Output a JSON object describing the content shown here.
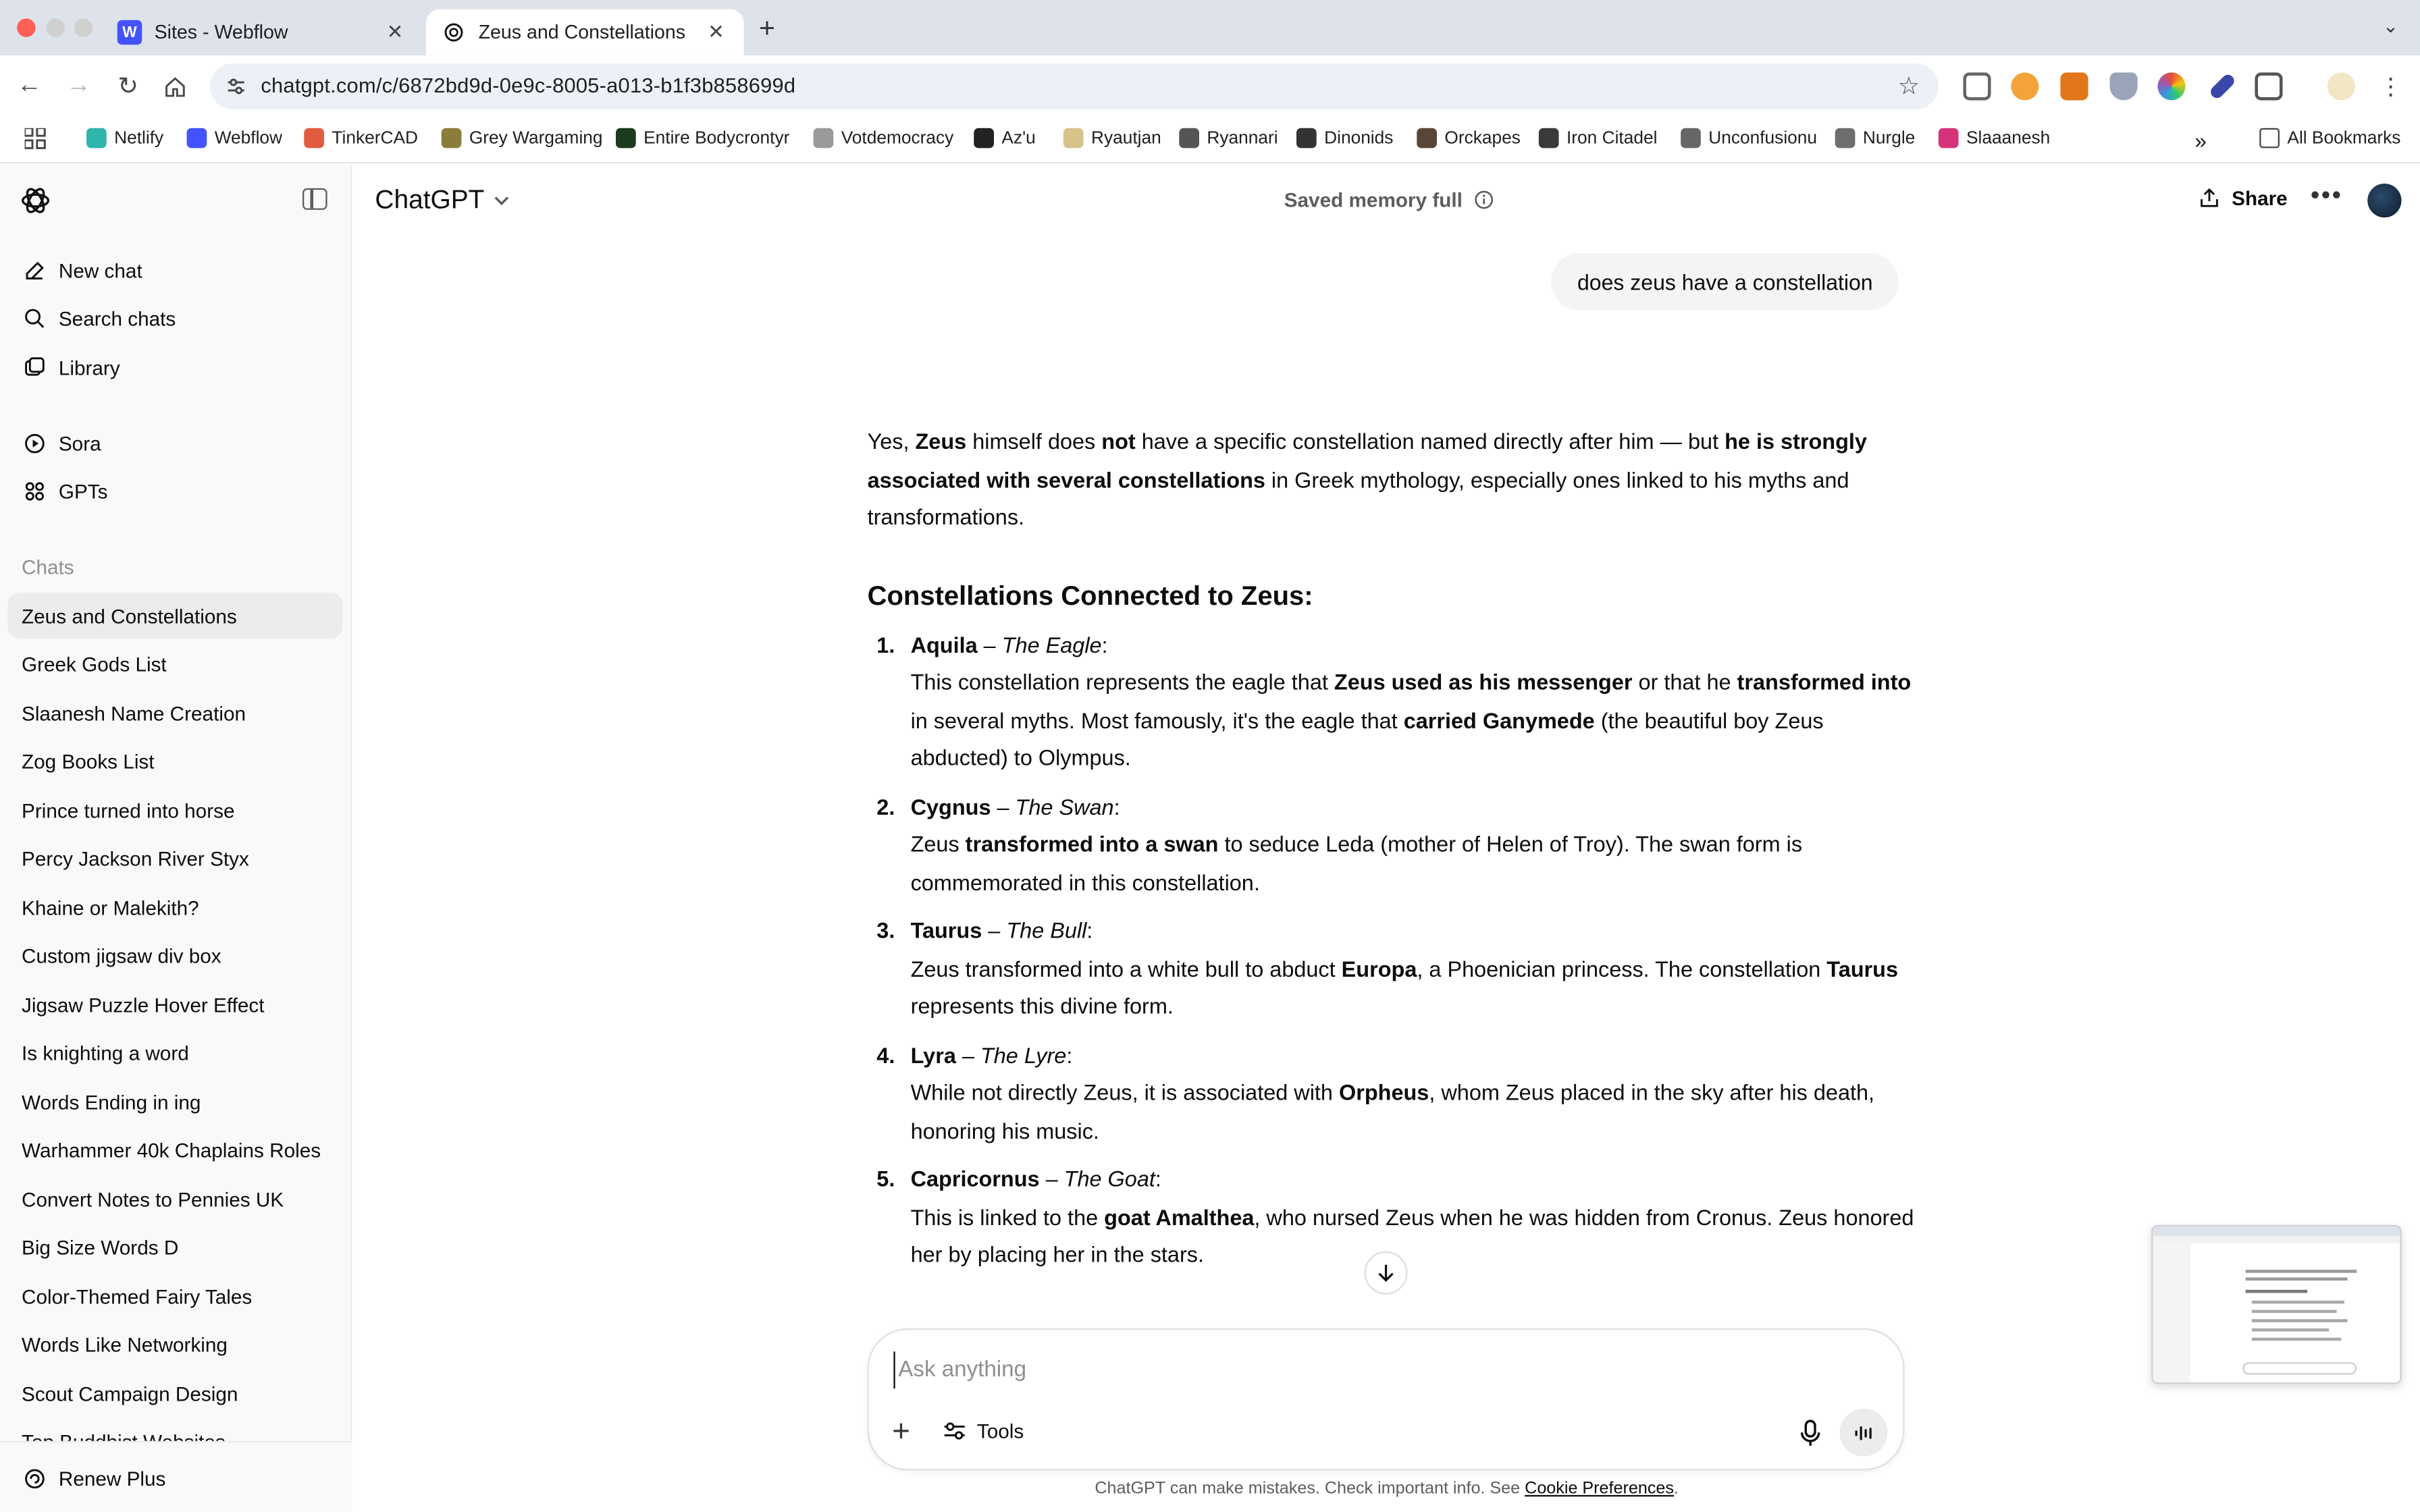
{
  "browser": {
    "tabs": [
      {
        "label": "Sites - Webflow",
        "favicon": "webflow-icon",
        "active": false
      },
      {
        "label": "Zeus and Constellations",
        "favicon": "openai-icon",
        "active": true
      }
    ],
    "url": "chatgpt.com/c/6872bd9d-0e9c-8005-a013-b1f3b858699d",
    "bookmarks": [
      {
        "label": "Netlify",
        "color": "#2fb5aa"
      },
      {
        "label": "Webflow",
        "color": "#4353ff"
      },
      {
        "label": "TinkerCAD",
        "color": "#e25b3e"
      },
      {
        "label": "Grey Wargaming",
        "color": "#8a7d3c"
      },
      {
        "label": "Entire Bodycrontyr",
        "color": "#1b3a1e"
      },
      {
        "label": "Votdemocracy",
        "color": "#9a9a9a"
      },
      {
        "label": "Az'u",
        "color": "#222222"
      },
      {
        "label": "Ryautjan",
        "color": "#d7c38a"
      },
      {
        "label": "Ryannari",
        "color": "#555555"
      },
      {
        "label": "Dinonids",
        "color": "#333333"
      },
      {
        "label": "Orckapes",
        "color": "#5a4636"
      },
      {
        "label": "Iron Citadel",
        "color": "#3a3a3a"
      },
      {
        "label": "Unconfusionu",
        "color": "#666666"
      },
      {
        "label": "Nurgle",
        "color": "#6e6e6e"
      },
      {
        "label": "Slaaanesh",
        "color": "#d6337a"
      }
    ],
    "all_bookmarks": "All Bookmarks"
  },
  "sidebar": {
    "nav": [
      {
        "label": "New chat",
        "icon": "compose-icon"
      },
      {
        "label": "Search chats",
        "icon": "search-icon"
      },
      {
        "label": "Library",
        "icon": "library-icon"
      }
    ],
    "apps": [
      {
        "label": "Sora",
        "icon": "play-icon"
      },
      {
        "label": "GPTs",
        "icon": "grid-icon"
      }
    ],
    "section_label": "Chats",
    "chats": [
      "Zeus and Constellations",
      "Greek Gods List",
      "Slaanesh Name Creation",
      "Zog Books List",
      "Prince turned into horse",
      "Percy Jackson River Styx",
      "Khaine or Malekith?",
      "Custom jigsaw div box",
      "Jigsaw Puzzle Hover Effect",
      "Is knighting a word",
      "Words Ending in ing",
      "Warhammer 40k Chaplains Roles",
      "Convert Notes to Pennies UK",
      "Big Size Words D",
      "Color-Themed Fairy Tales",
      "Words Like Networking",
      "Scout Campaign Design",
      "Top Buddhist Websites"
    ],
    "renew": "Renew Plus"
  },
  "header": {
    "model": "ChatGPT",
    "memory": "Saved memory full",
    "share": "Share"
  },
  "conversation": {
    "user_message": "does zeus have a constellation",
    "intro": {
      "p1": "Yes, ",
      "b1": "Zeus",
      "p2": " himself does ",
      "b2": "not",
      "p3": " have a specific constellation named directly after him — but ",
      "b3": "he is strongly associated with several constellations",
      "p4": " in Greek mythology, especially ones linked to his myths and transformations."
    },
    "heading": "Constellations Connected to Zeus:",
    "items": [
      {
        "num": "1.",
        "name": "Aquila",
        "dash": " – ",
        "sub": "The Eagle",
        "colon": ":",
        "parts": [
          {
            "t": "This constellation represents the eagle that ",
            "b": false
          },
          {
            "t": "Zeus used as his messenger",
            "b": true
          },
          {
            "t": " or that he ",
            "b": false
          },
          {
            "t": "transformed into",
            "b": true
          },
          {
            "t": " in several myths. Most famously, it's the eagle that ",
            "b": false
          },
          {
            "t": "carried Ganymede",
            "b": true
          },
          {
            "t": " (the beautiful boy Zeus abducted) to Olympus.",
            "b": false
          }
        ]
      },
      {
        "num": "2.",
        "name": "Cygnus",
        "dash": " – ",
        "sub": "The Swan",
        "colon": ":",
        "parts": [
          {
            "t": "Zeus ",
            "b": false
          },
          {
            "t": "transformed into a swan",
            "b": true
          },
          {
            "t": " to seduce Leda (mother of Helen of Troy). The swan form is commemorated in this constellation.",
            "b": false
          }
        ]
      },
      {
        "num": "3.",
        "name": "Taurus",
        "dash": " – ",
        "sub": "The Bull",
        "colon": ":",
        "parts": [
          {
            "t": "Zeus transformed into a white bull to abduct ",
            "b": false
          },
          {
            "t": "Europa",
            "b": true
          },
          {
            "t": ", a Phoenician princess. The constellation ",
            "b": false
          },
          {
            "t": "Taurus",
            "b": true
          },
          {
            "t": " represents this divine form.",
            "b": false
          }
        ]
      },
      {
        "num": "4.",
        "name": "Lyra",
        "dash": " – ",
        "sub": "The Lyre",
        "colon": ":",
        "parts": [
          {
            "t": "While not directly Zeus, it is associated with ",
            "b": false
          },
          {
            "t": "Orpheus",
            "b": true
          },
          {
            "t": ", whom Zeus placed in the sky after his death, honoring his music.",
            "b": false
          }
        ]
      },
      {
        "num": "5.",
        "name": "Capricornus",
        "dash": " – ",
        "sub": "The Goat",
        "colon": ":",
        "parts": [
          {
            "t": "This is linked to the ",
            "b": false
          },
          {
            "t": "goat Amalthea",
            "b": true
          },
          {
            "t": ", who nursed Zeus when he was hidden from Cronus. Zeus honored her by placing her in the stars.",
            "b": false
          }
        ]
      }
    ]
  },
  "composer": {
    "placeholder": "Ask anything",
    "tools": "Tools"
  },
  "footer": {
    "text": "ChatGPT can make mistakes. Check important info. See ",
    "link": "Cookie Preferences",
    "end": "."
  }
}
